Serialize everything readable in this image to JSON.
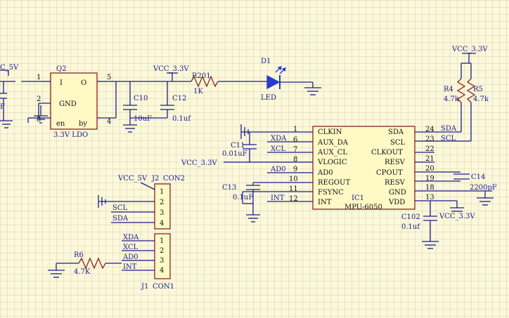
{
  "colors": {
    "background": "#fbf8dc",
    "grid": "#d8d2a8",
    "wire": "#1c1c8c",
    "component_body": "#fff9c6",
    "component_outline": "#8a2222",
    "led": "#2a3ad2",
    "resistor": "#8a2222",
    "text": "#111111"
  },
  "nets": {
    "vcc_5v_left": "C_5V",
    "vcc_3v3_ldo": "VCC_3.3V",
    "vcc_3v3_top": "VCC_3.3V",
    "vcc_3v3_vlogic": "VCC_3.3V",
    "vcc_3v3_vdd": "VCC_3.3V",
    "vcc_5v_j2": "VCC_5V"
  },
  "q2": {
    "ref": "Q2",
    "value": "3.3V LDO",
    "pins": {
      "i": "I",
      "o": "O",
      "gnd": "GND",
      "en": "en",
      "by": "by"
    },
    "pin_numbers": {
      "p1": "1",
      "p2": "2",
      "p3": "3",
      "p4": "4",
      "p5": "5"
    }
  },
  "c10": {
    "ref": "C10",
    "value": "10uF"
  },
  "c12": {
    "ref": "C12",
    "value": "0.1uf"
  },
  "left_cap_value": "F",
  "r201": {
    "ref": "R201",
    "value": "1K"
  },
  "d1": {
    "ref": "D1",
    "value": "LED"
  },
  "r4": {
    "ref": "R4",
    "value": "4.7k"
  },
  "r5": {
    "ref": "R5",
    "value": "4.7k"
  },
  "c11": {
    "ref": "C11",
    "value": "0.01uF"
  },
  "c13": {
    "ref": "C13",
    "value": "0.1uF"
  },
  "c14": {
    "ref": "C14",
    "value": "2200pF"
  },
  "c102": {
    "ref": "C102",
    "value": "0.1uf"
  },
  "r6": {
    "ref": "R6",
    "value": "4.7K"
  },
  "ic1": {
    "ref": "IC1",
    "value": "MPU-6050",
    "left_pins": [
      {
        "name": "CLKIN",
        "num": "1"
      },
      {
        "name": "AUX_DA",
        "num": "6"
      },
      {
        "name": "AUX_CL",
        "num": "7"
      },
      {
        "name": "VLOGIC",
        "num": "8"
      },
      {
        "name": "AD0",
        "num": "9"
      },
      {
        "name": "REGOUT",
        "num": "10"
      },
      {
        "name": "FSYNC",
        "num": "11"
      },
      {
        "name": "INT",
        "num": "12"
      }
    ],
    "right_pins": [
      {
        "name": "SDA",
        "num": "24"
      },
      {
        "name": "SCL",
        "num": "23"
      },
      {
        "name": "CLKOUT",
        "num": "22"
      },
      {
        "name": "RESV",
        "num": "21"
      },
      {
        "name": "CPOUT",
        "num": "20"
      },
      {
        "name": "RESV",
        "num": "19"
      },
      {
        "name": "GND",
        "num": "18"
      },
      {
        "name": "VDD",
        "num": "13"
      }
    ]
  },
  "ic_left_nets": {
    "xda": "XDA",
    "xcl": "XCL",
    "ad0": "AD0",
    "int": "INT"
  },
  "ic_right_nets": {
    "sda": "SDA",
    "scl": "SCL"
  },
  "j2": {
    "ref": "J2",
    "value": "CON2",
    "pin_numbers": [
      "1",
      "2",
      "3",
      "4"
    ],
    "nets": {
      "scl": "SCL",
      "sda": "SDA"
    }
  },
  "j1": {
    "ref": "J1",
    "value": "CON1",
    "pin_numbers": [
      "1",
      "2",
      "3",
      "4"
    ],
    "nets": {
      "xda": "XDA",
      "xcl": "XCL",
      "ad0": "AD0",
      "int": "INT"
    }
  }
}
